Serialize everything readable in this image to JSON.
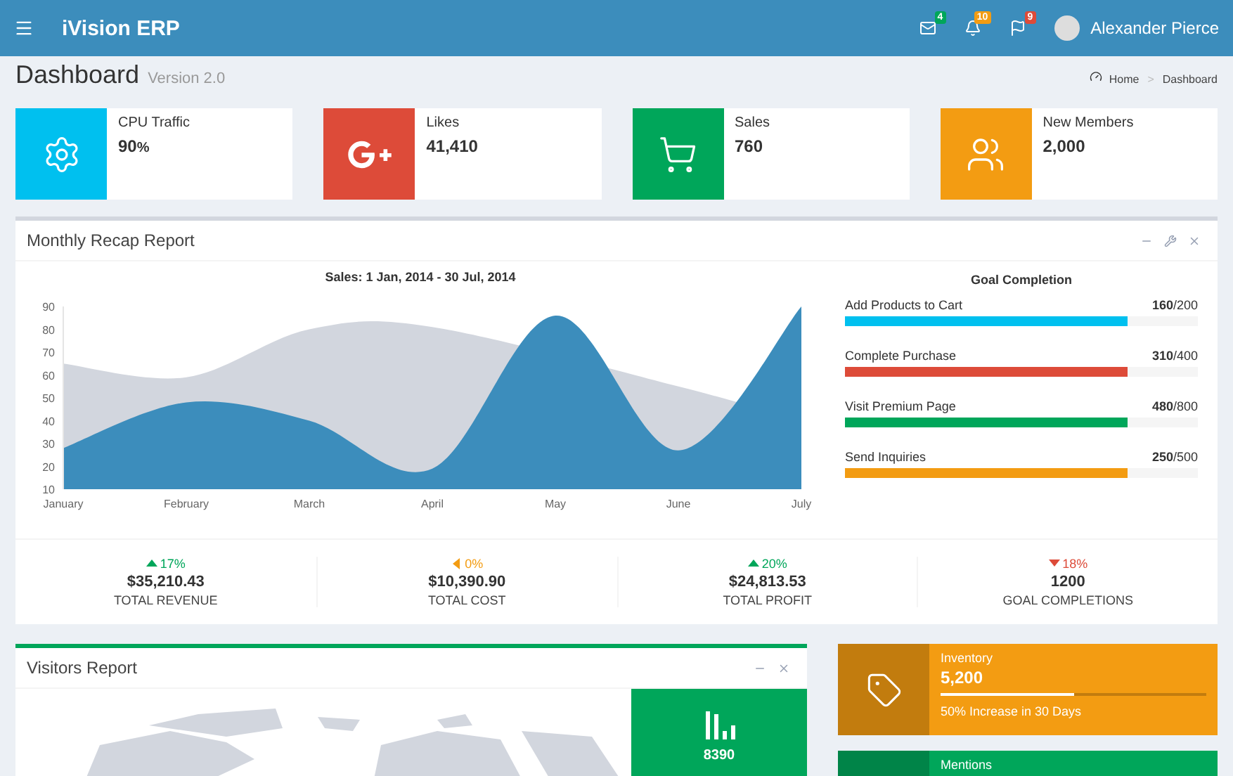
{
  "header": {
    "logo": "iVision ERP",
    "notifications": [
      {
        "kind": "mail",
        "count": "4",
        "color": "#00a65a"
      },
      {
        "kind": "bell",
        "count": "10",
        "color": "#f39c12"
      },
      {
        "kind": "flag",
        "count": "9",
        "color": "#dd4b39"
      }
    ],
    "user": "Alexander Pierce"
  },
  "page": {
    "title": "Dashboard",
    "subtitle": "Version 2.0",
    "breadcrumb": [
      "Home",
      "Dashboard"
    ],
    "separator": ">"
  },
  "info_boxes": [
    {
      "kind": "gear",
      "label": "CPU Traffic",
      "value": "90",
      "unit": "%",
      "color": "#00c0ef"
    },
    {
      "kind": "gplus",
      "label": "Likes",
      "value": "41,410",
      "color": "#dd4b39"
    },
    {
      "kind": "cart",
      "label": "Sales",
      "value": "760",
      "color": "#00a65a"
    },
    {
      "kind": "people",
      "label": "New Members",
      "value": "2,000",
      "color": "#f39c12"
    }
  ],
  "recap": {
    "title": "Monthly Recap Report",
    "chart_data": {
      "type": "area",
      "title": "Sales: 1 Jan, 2014 - 30 Jul, 2014",
      "categories": [
        "January",
        "February",
        "March",
        "April",
        "May",
        "June",
        "July"
      ],
      "ylim": [
        10,
        90
      ],
      "yticks": [
        10,
        20,
        30,
        40,
        50,
        60,
        70,
        80,
        90
      ],
      "series": [
        {
          "color": "#d2d6de",
          "values": [
            65,
            59,
            80,
            81,
            null,
            55,
            40
          ]
        },
        {
          "color": "#3c8dbc",
          "values": [
            28,
            48,
            40,
            19,
            86,
            27,
            90
          ]
        }
      ]
    },
    "goals_title": "Goal Completion",
    "goals": [
      {
        "label": "Add Products to Cart",
        "done": "160",
        "total": "/200",
        "level": 0.8,
        "color": "#00c0ef"
      },
      {
        "label": "Complete Purchase",
        "done": "310",
        "total": "/400",
        "level": 0.8,
        "color": "#dd4b39"
      },
      {
        "label": "Visit Premium Page",
        "done": "480",
        "total": "/800",
        "level": 0.8,
        "color": "#00a65a"
      },
      {
        "label": "Send Inquiries",
        "done": "250",
        "total": "/500",
        "level": 0.8,
        "color": "#f39c12"
      }
    ],
    "stats": [
      {
        "kind": "up",
        "change": "17%",
        "color": "#00a65a",
        "amount": "$35,210.43",
        "label": "TOTAL REVENUE"
      },
      {
        "kind": "left",
        "change": "0%",
        "color": "#f39c12",
        "amount": "$10,390.90",
        "label": "TOTAL COST"
      },
      {
        "kind": "up",
        "change": "20%",
        "color": "#00a65a",
        "amount": "$24,813.53",
        "label": "TOTAL PROFIT"
      },
      {
        "kind": "down",
        "change": "18%",
        "color": "#dd4b39",
        "amount": "1200",
        "label": "GOAL COMPLETIONS"
      }
    ]
  },
  "visitors": {
    "title": "Visitors Report",
    "stat": "8390"
  },
  "side_boxes": [
    {
      "kind": "tag",
      "label": "Inventory",
      "value": "5,200",
      "level": 0.5,
      "note": "50% Increase in 30 Days",
      "color": "#f39c12"
    },
    {
      "label": "Mentions",
      "color": "#00a65a"
    }
  ]
}
